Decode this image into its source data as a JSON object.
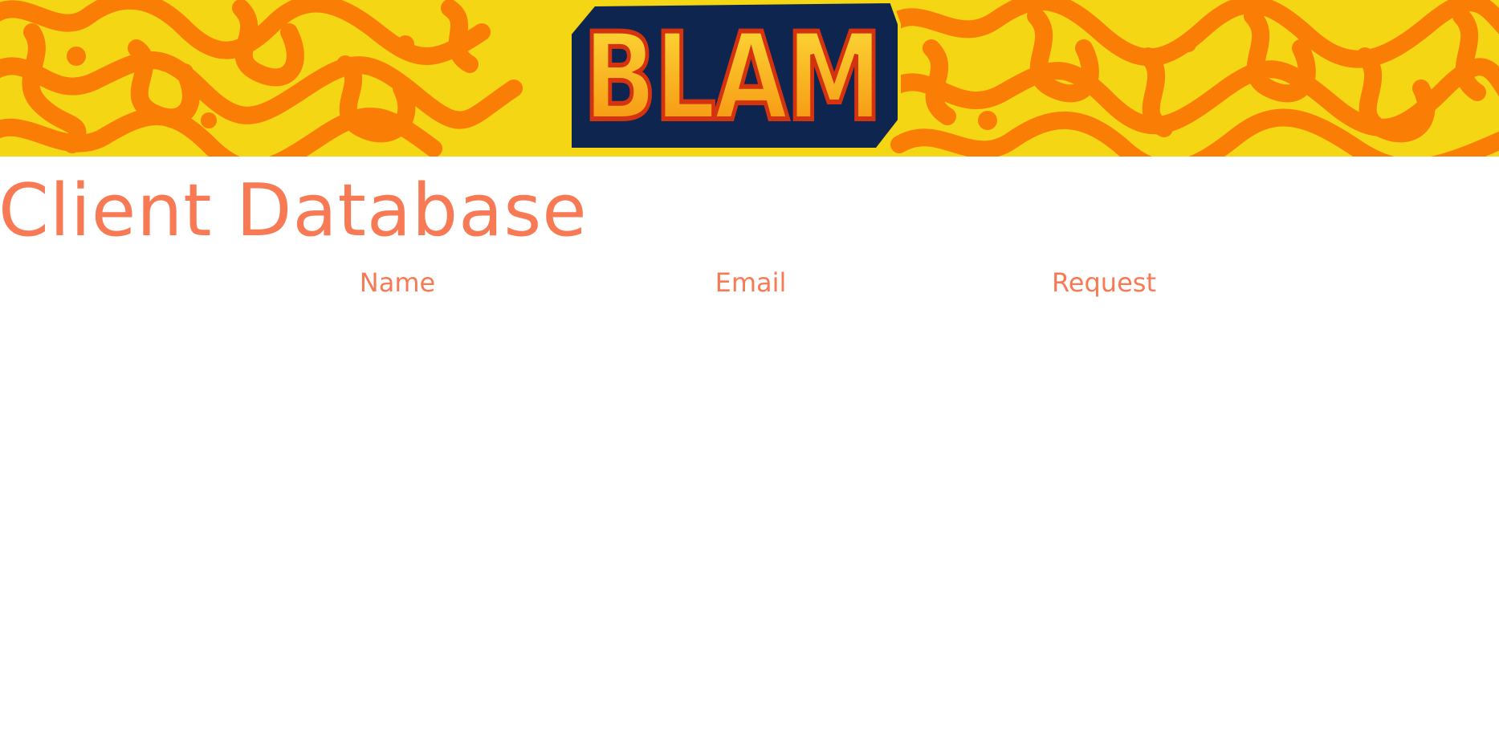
{
  "brand": {
    "logo_text": "BLAM",
    "colors": {
      "banner_yellow": "#f4d614",
      "banner_orange": "#fa7d06",
      "logo_navy": "#0e2550",
      "logo_outline": "#d5320f",
      "accent": "#f77a55"
    }
  },
  "page": {
    "title": "Client Database"
  },
  "table": {
    "columns": [
      "Name",
      "Email",
      "Request"
    ],
    "rows": []
  }
}
